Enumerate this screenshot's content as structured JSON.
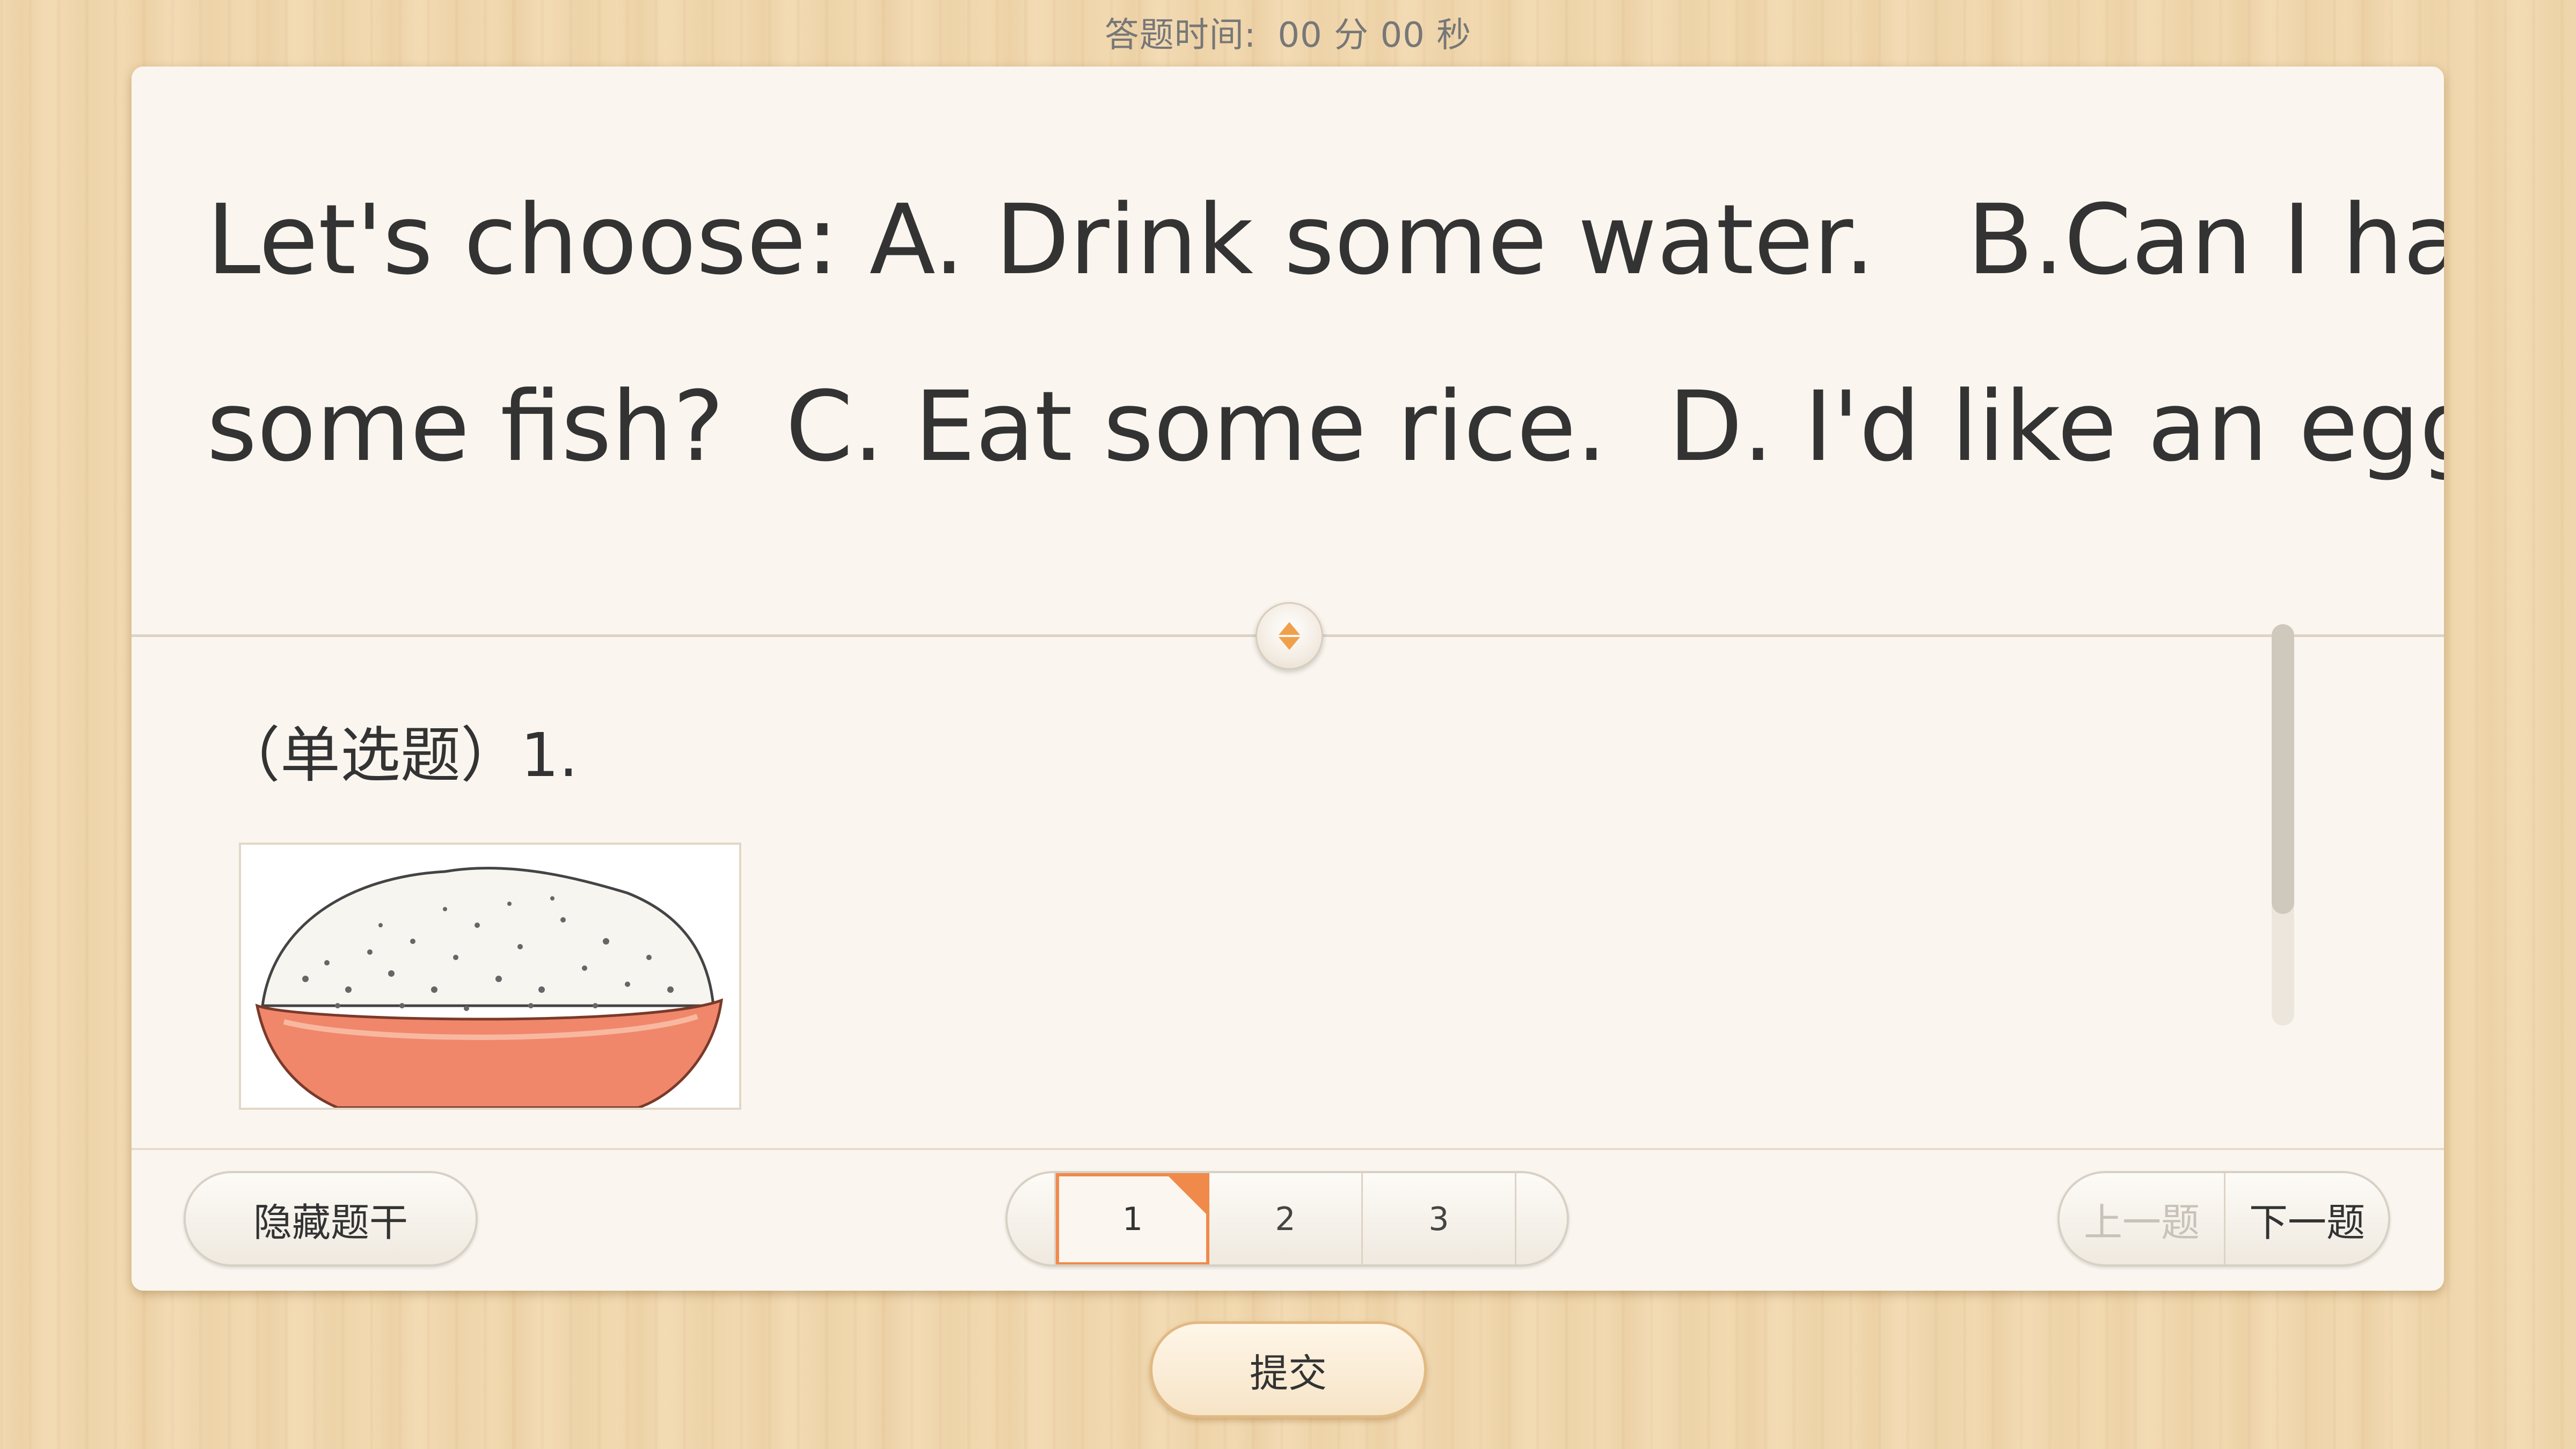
{
  "timer": {
    "label": "答题时间:",
    "value": "00 分 00 秒"
  },
  "stem": {
    "text_line1": "Let's choose: A. Drink some water.   B.Can I have",
    "text_line2": "some fish?  C. Eat some rice.  D. I'd like an egg."
  },
  "question": {
    "label": "（单选题）1.",
    "image_icon": "bowl-of-rice-image"
  },
  "footer": {
    "hide_stem_label": "隐藏题干",
    "pages": [
      "1",
      "2",
      "3"
    ],
    "current_page": "1",
    "prev_label": "上一题",
    "next_label": "下一题"
  },
  "submit_label": "提交",
  "colors": {
    "accent": "#f08a4b",
    "card_bg": "#faf6ef",
    "submit_border": "#e2b983"
  }
}
